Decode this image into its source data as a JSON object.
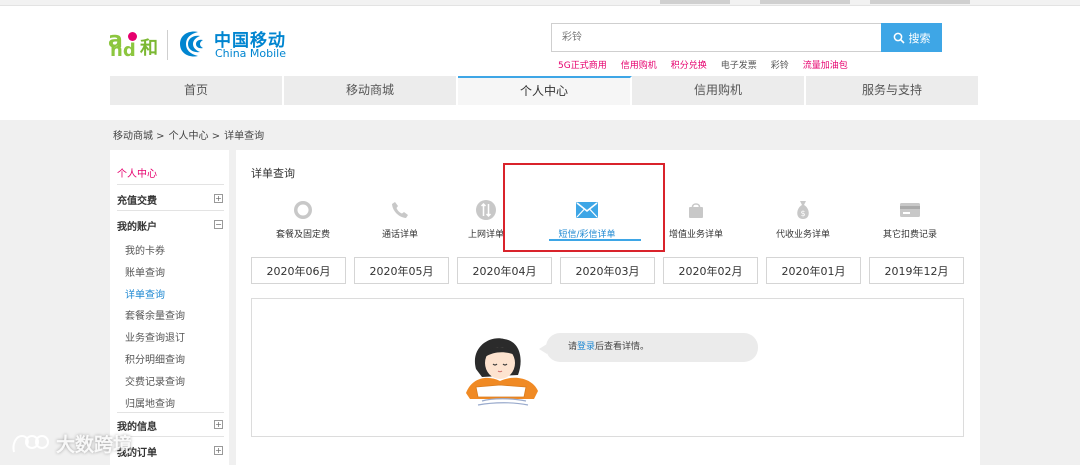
{
  "brand": {
    "logo_text": "and和",
    "company_cn": "中国移动",
    "company_en": "China Mobile"
  },
  "search": {
    "placeholder": "彩铃",
    "button_label": "搜索",
    "hot_links": [
      {
        "label": "5G正式商用",
        "color": "#e6006e"
      },
      {
        "label": "信用购机",
        "color": "#e6006e"
      },
      {
        "label": "积分兑换",
        "color": "#e6006e"
      },
      {
        "label": "电子发票",
        "color": "#555555"
      },
      {
        "label": "彩铃",
        "color": "#555555"
      },
      {
        "label": "流量加油包",
        "color": "#e6006e"
      }
    ]
  },
  "nav": {
    "items": [
      "首页",
      "移动商城",
      "个人中心",
      "信用购机",
      "服务与支持"
    ],
    "active_index": 2
  },
  "breadcrumb": [
    "移动商城 >",
    "个人中心 >",
    "详单查询"
  ],
  "sidebar": {
    "title": "个人中心",
    "recharge": "充值交费",
    "my_account": "我的账户",
    "account_items": [
      "我的卡券",
      "账单查询",
      "详单查询",
      "套餐余量查询",
      "业务查询退订",
      "积分明细查询",
      "交费记录查询",
      "归属地查询"
    ],
    "active_item": "详单查询",
    "my_info": "我的信息",
    "my_orders": "我的订单"
  },
  "main": {
    "title": "详单查询",
    "categories": [
      {
        "label": "套餐及固定费",
        "icon": "circle-icon"
      },
      {
        "label": "通话详单",
        "icon": "phone-icon"
      },
      {
        "label": "上网详单",
        "icon": "data-icon"
      },
      {
        "label": "短信/彩信详单",
        "icon": "mail-icon"
      },
      {
        "label": "增值业务详单",
        "icon": "bag-icon"
      },
      {
        "label": "代收业务详单",
        "icon": "money-bag-icon"
      },
      {
        "label": "其它扣费记录",
        "icon": "card-icon"
      }
    ],
    "active_category": 3,
    "months": [
      "2020年06月",
      "2020年05月",
      "2020年04月",
      "2020年03月",
      "2020年02月",
      "2020年01月",
      "2019年12月"
    ],
    "login_prompt": {
      "prefix": "请",
      "link": "登录",
      "suffix": "后查看详情。"
    }
  },
  "watermark": "大数跨境",
  "colors": {
    "accent_blue": "#3ea6e6",
    "brand_pink": "#e6006e",
    "highlight_red": "#d9232b"
  }
}
